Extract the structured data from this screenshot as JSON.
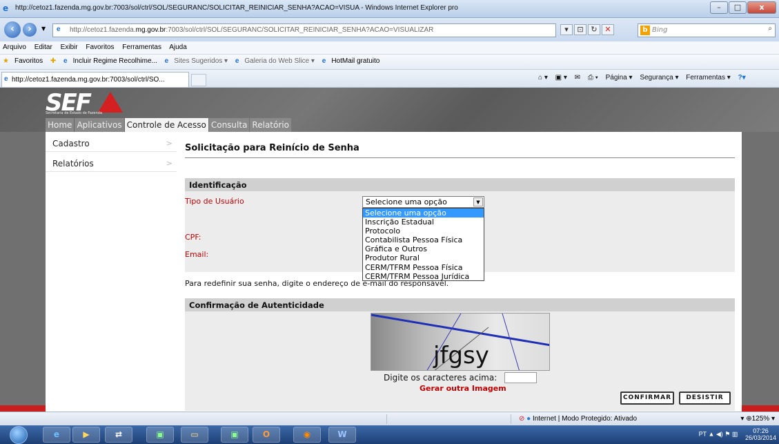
{
  "window": {
    "title": "http://cetoz1.fazenda.mg.gov.br:7003/sol/ctrl/SOL/SEGURANC/SOLICITAR_REINICIAR_SENHA?ACAO=VISUA - Windows Internet Explorer pro",
    "controls": {
      "minimize": "–",
      "maximize": "□",
      "close": "x"
    }
  },
  "address": {
    "url_prefix": "http://cetoz1.fazenda.",
    "url_domain": "mg.gov.br",
    "url_suffix": ":7003/sol/ctrl/SOL/SEGURANC/SOLICITAR_REINICIAR_SENHA?ACAO=VISUALIZAR",
    "search_placeholder": "Bing",
    "search_logo": "b"
  },
  "menu": [
    "Arquivo",
    "Editar",
    "Exibir",
    "Favoritos",
    "Ferramentas",
    "Ajuda"
  ],
  "favorites": {
    "label": "Favoritos",
    "items": [
      "Incluir Regime Recolhime...",
      "Sites Sugeridos ▾",
      "Galeria do Web Slice ▾",
      "HotMail gratuito"
    ]
  },
  "tab": {
    "title": "http://cetoz1.fazenda.mg.gov.br:7003/sol/ctrl/SO..."
  },
  "commands": [
    "Página ▾",
    "Segurança ▾",
    "Ferramentas ▾"
  ],
  "site": {
    "logo_text": "SEF",
    "logo_subtitle": "Secretaria de Estado de Fazenda",
    "nav": [
      "Home",
      "Aplicativos",
      "Controle de Acesso",
      "Consulta",
      "Relatório"
    ],
    "active_nav": "Controle de Acesso"
  },
  "sidebar": {
    "items": [
      {
        "label": "Cadastro"
      },
      {
        "label": "Relatórios"
      }
    ]
  },
  "form": {
    "title": "Solicitação para Reinício de Senha",
    "identificacao": "Identificação",
    "tipo_label": "Tipo de Usuário",
    "cpf_label": "CPF:",
    "email_label": "Email:",
    "select_value": "Selecione uma opção",
    "options": [
      "Selecione uma opção",
      "Inscrição Estadual",
      "Protocolo",
      "Contabilista Pessoa Física",
      "Gráfica e Outros",
      "Produtor Rural",
      "CERM/TFRM Pessoa Física",
      "CERM/TFRM Pessoa Jurídica"
    ],
    "redefinir_text": "Para redefinir sua senha, digite o endereço de e-mail do responsável.",
    "confirmacao": "Confirmação de Autenticidade",
    "captcha_text": "jfgsy",
    "digite": "Digite os caracteres acima:",
    "gerar": "Gerar outra Imagem",
    "confirmar": "CONFIRMAR",
    "desistir": "DESISTIR"
  },
  "status": {
    "zone": "Internet | Modo Protegido: Ativado",
    "zoom": "125%"
  },
  "taskbar": {
    "lang": "PT",
    "time": "07:26",
    "date": "26/03/2014",
    "apps": [
      "ie",
      "media",
      "network",
      "terminal",
      "explorer",
      "terminal2",
      "outlook",
      "firefox",
      "word"
    ]
  },
  "colors": {
    "accent_red": "#c81e1e",
    "label_red": "#c00000",
    "highlight": "#3399ff"
  }
}
